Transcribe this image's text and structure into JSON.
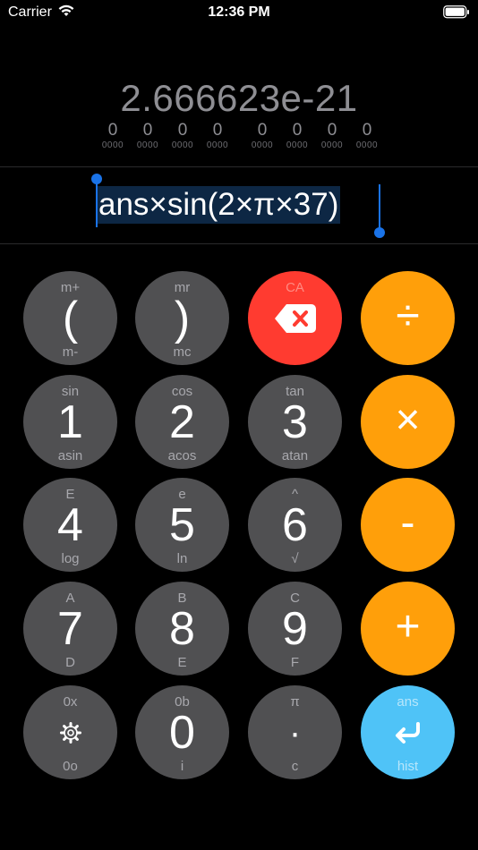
{
  "status_bar": {
    "carrier": "Carrier",
    "time": "12:36 PM"
  },
  "display": {
    "result": "2.666623e-21",
    "nibbles": [
      {
        "digit": "0",
        "bits": "0000"
      },
      {
        "digit": "0",
        "bits": "0000"
      },
      {
        "digit": "0",
        "bits": "0000"
      },
      {
        "digit": "0",
        "bits": "0000"
      },
      {
        "digit": "0",
        "bits": "0000"
      },
      {
        "digit": "0",
        "bits": "0000"
      },
      {
        "digit": "0",
        "bits": "0000"
      },
      {
        "digit": "0",
        "bits": "0000"
      }
    ],
    "expression": "ans×sin(2×π×37)"
  },
  "keys": {
    "open_paren": {
      "top": "m+",
      "main": "(",
      "bottom": "m-"
    },
    "close_paren": {
      "top": "mr",
      "main": ")",
      "bottom": "mc"
    },
    "delete": {
      "top": "CA",
      "icon": "backspace-icon"
    },
    "divide": {
      "main": "÷"
    },
    "one": {
      "top": "sin",
      "main": "1",
      "bottom": "asin"
    },
    "two": {
      "top": "cos",
      "main": "2",
      "bottom": "acos"
    },
    "three": {
      "top": "tan",
      "main": "3",
      "bottom": "atan"
    },
    "multiply": {
      "main": "×"
    },
    "four": {
      "top": "E",
      "main": "4",
      "bottom": "log"
    },
    "five": {
      "top": "e",
      "main": "5",
      "bottom": "ln"
    },
    "six": {
      "top": "^",
      "main": "6",
      "bottom": "√"
    },
    "minus": {
      "main": "-"
    },
    "seven": {
      "top": "A",
      "main": "7",
      "bottom": "D"
    },
    "eight": {
      "top": "B",
      "main": "8",
      "bottom": "E"
    },
    "nine": {
      "top": "C",
      "main": "9",
      "bottom": "F"
    },
    "plus": {
      "main": "+"
    },
    "settings": {
      "top": "0x",
      "icon": "gear-icon",
      "bottom": "0o"
    },
    "zero": {
      "top": "0b",
      "main": "0",
      "bottom": "i"
    },
    "dot": {
      "top": "π",
      "main": "·",
      "bottom": "c"
    },
    "enter": {
      "top": "ans",
      "icon": "return-icon",
      "bottom": "hist"
    }
  },
  "colors": {
    "gray_key": "#505052",
    "orange_key": "#ff9f0a",
    "delete_key": "#ff3b30",
    "enter_key": "#4fc3f7",
    "selection": "#0d2744",
    "selection_handle": "#1a73e8"
  }
}
